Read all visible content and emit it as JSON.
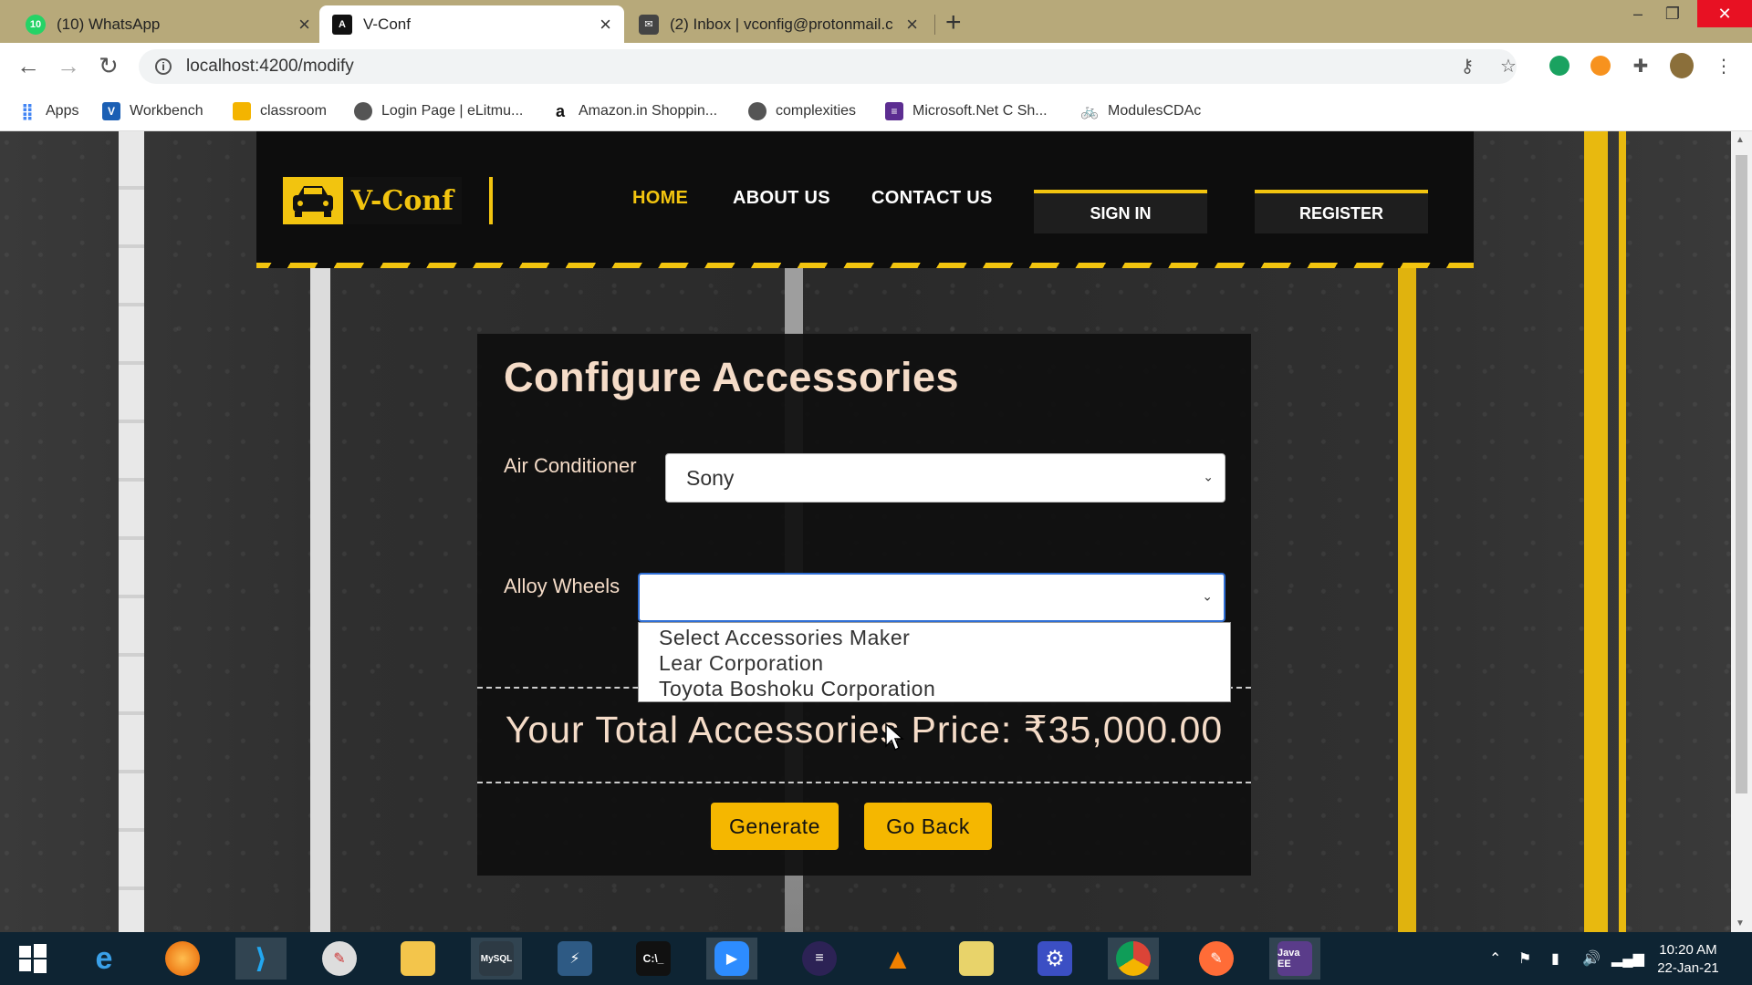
{
  "browser": {
    "tabs": [
      {
        "title": "(10) WhatsApp",
        "badge": "10",
        "active": false
      },
      {
        "title": "V-Conf",
        "active": true
      },
      {
        "title": "(2) Inbox | vconfig@protonmail.c",
        "active": false
      }
    ],
    "url": "localhost:4200/modify",
    "bookmarks": [
      {
        "label": "Apps",
        "icon": "apps-grid-icon"
      },
      {
        "label": "Workbench",
        "icon": "workbench-icon"
      },
      {
        "label": "classroom",
        "icon": "classroom-icon"
      },
      {
        "label": "Login Page | eLitmu...",
        "icon": "globe-icon"
      },
      {
        "label": "Amazon.in Shoppin...",
        "icon": "amazon-icon"
      },
      {
        "label": "complexities",
        "icon": "globe-icon"
      },
      {
        "label": "Microsoft.Net C Sh...",
        "icon": "list-icon"
      },
      {
        "label": "ModulesCDAc",
        "icon": "bike-icon"
      }
    ]
  },
  "site": {
    "logo_text": "V-Conf",
    "nav": {
      "home": "HOME",
      "about": "ABOUT US",
      "contact": "CONTACT US"
    },
    "sign_in": "SIGN IN",
    "register": "REGISTER",
    "accent_color": "#f2c40f"
  },
  "form": {
    "title": "Configure Accessories",
    "air_conditioner": {
      "label": "Air Conditioner",
      "value": "Sony"
    },
    "alloy_wheels": {
      "label": "Alloy Wheels",
      "value": "",
      "options": [
        "Select Accessories Maker",
        "Lear Corporation",
        "Toyota Boshoku Corporation"
      ]
    },
    "total_text": "Your Total Accessories Price: ₹35,000.00",
    "generate": "Generate",
    "go_back": "Go Back",
    "button_color": "#f5b700"
  },
  "taskbar": {
    "time": "10:20 AM",
    "date": "22-Jan-21"
  }
}
